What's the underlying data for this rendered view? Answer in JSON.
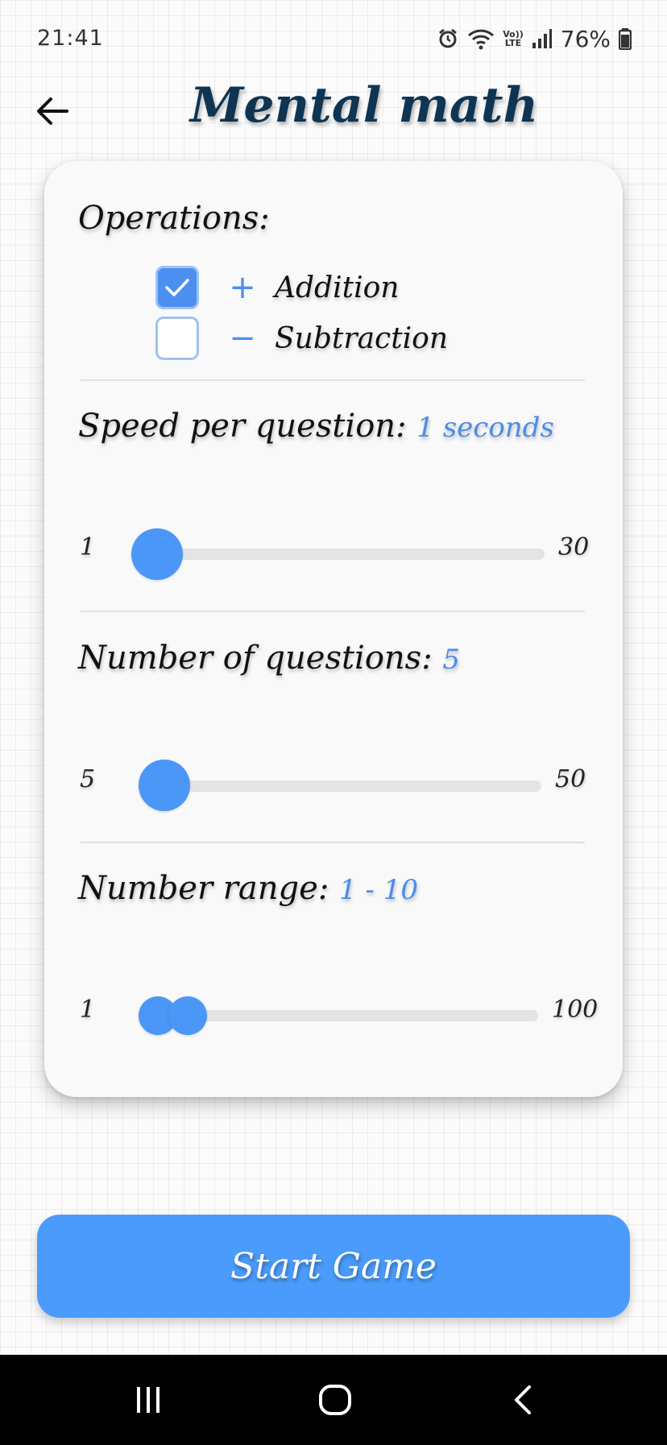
{
  "status_bar": {
    "time": "21:41",
    "network": "LTE",
    "volte": "Vo))",
    "battery": "76%"
  },
  "app_bar": {
    "title": "Mental math",
    "back_icon": "arrow-left-icon"
  },
  "operations": {
    "title": "Operations:",
    "items": [
      {
        "symbol": "+",
        "label": "Addition",
        "checked": true
      },
      {
        "symbol": "−",
        "label": "Subtraction",
        "checked": false
      }
    ]
  },
  "speed": {
    "title": "Speed per question:",
    "value_text": "1 seconds",
    "min": "1",
    "max": "30",
    "value": 1
  },
  "questions": {
    "title": "Number of questions:",
    "value_text": "5",
    "min": "5",
    "max": "50",
    "value": 5
  },
  "range": {
    "title": "Number range:",
    "value_text": "1 - 10",
    "min": "1",
    "max": "100",
    "low": 1,
    "high": 10
  },
  "start_button": {
    "label": "Start Game"
  },
  "colors": {
    "accent": "#4b8ff0",
    "button": "#4a9bfb",
    "title": "#0f3552"
  },
  "nav_bar": {
    "items": [
      "recent-apps-icon",
      "home-icon",
      "back-icon"
    ]
  }
}
